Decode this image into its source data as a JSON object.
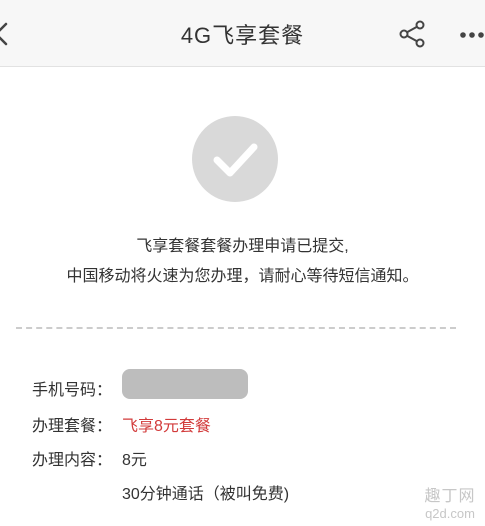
{
  "header": {
    "title": "4G飞享套餐",
    "back_icon": "back-arrow-icon",
    "share_icon": "share-icon",
    "more_icon": "more-icon"
  },
  "status": {
    "icon": "check-circle-icon",
    "message_line1": "飞享套餐套餐办理申请已提交,",
    "message_line2": "中国移动将火速为您办理，请耐心等待短信通知。"
  },
  "details": {
    "phone_label": "手机号码：",
    "plan_label": "办理套餐：",
    "plan_value": "飞享8元套餐",
    "content_label": "办理内容：",
    "content_value": "8元",
    "content_extra": "30分钟通话（被叫免费)"
  },
  "watermark": {
    "main": "趣丁网",
    "url": "q2d.com"
  },
  "colors": {
    "header_bg": "#f7f7f7",
    "accent_red": "#d23a3a",
    "success_gray": "#d9d9d9"
  }
}
